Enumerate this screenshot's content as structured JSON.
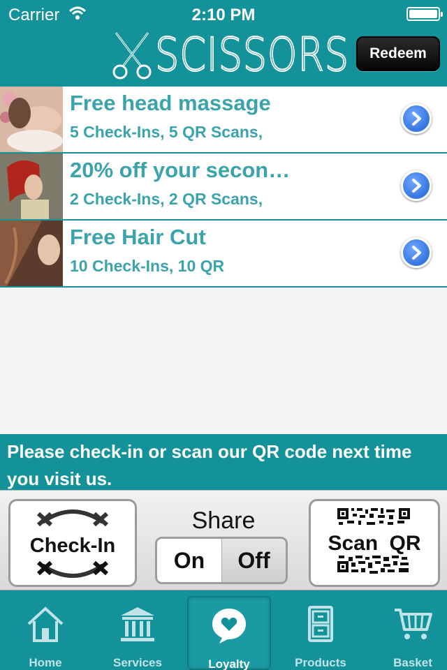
{
  "status_bar": {
    "carrier": "Carrier",
    "time": "2:10 PM"
  },
  "header": {
    "brand": "SCISSORS",
    "redeem_label": "Redeem"
  },
  "rewards": [
    {
      "title": "Free head massage",
      "subtitle": "5 Check-Ins, 5 QR Scans,"
    },
    {
      "title": "20% off your secon…",
      "subtitle": "2 Check-Ins, 2 QR Scans,"
    },
    {
      "title": "Free Hair Cut",
      "subtitle": "10 Check-Ins, 10 QR"
    }
  ],
  "banner": {
    "text": "Please check-in or scan our QR code next time you visit us."
  },
  "actions": {
    "checkin_label": "Check-In",
    "share_title": "Share",
    "share_on": "On",
    "share_off": "Off",
    "scan_label": "Scan QR"
  },
  "tabs": [
    {
      "label": "Home",
      "icon": "home-icon"
    },
    {
      "label": "Services",
      "icon": "bank-icon"
    },
    {
      "label": "Loyalty",
      "icon": "heart-bubble-icon",
      "active": true
    },
    {
      "label": "Products",
      "icon": "cabinet-icon"
    },
    {
      "label": "Basket",
      "icon": "cart-icon"
    }
  ],
  "colors": {
    "brand": "#14929a",
    "row_text": "#3aa3ab",
    "chevron": "#2a6fe0"
  }
}
